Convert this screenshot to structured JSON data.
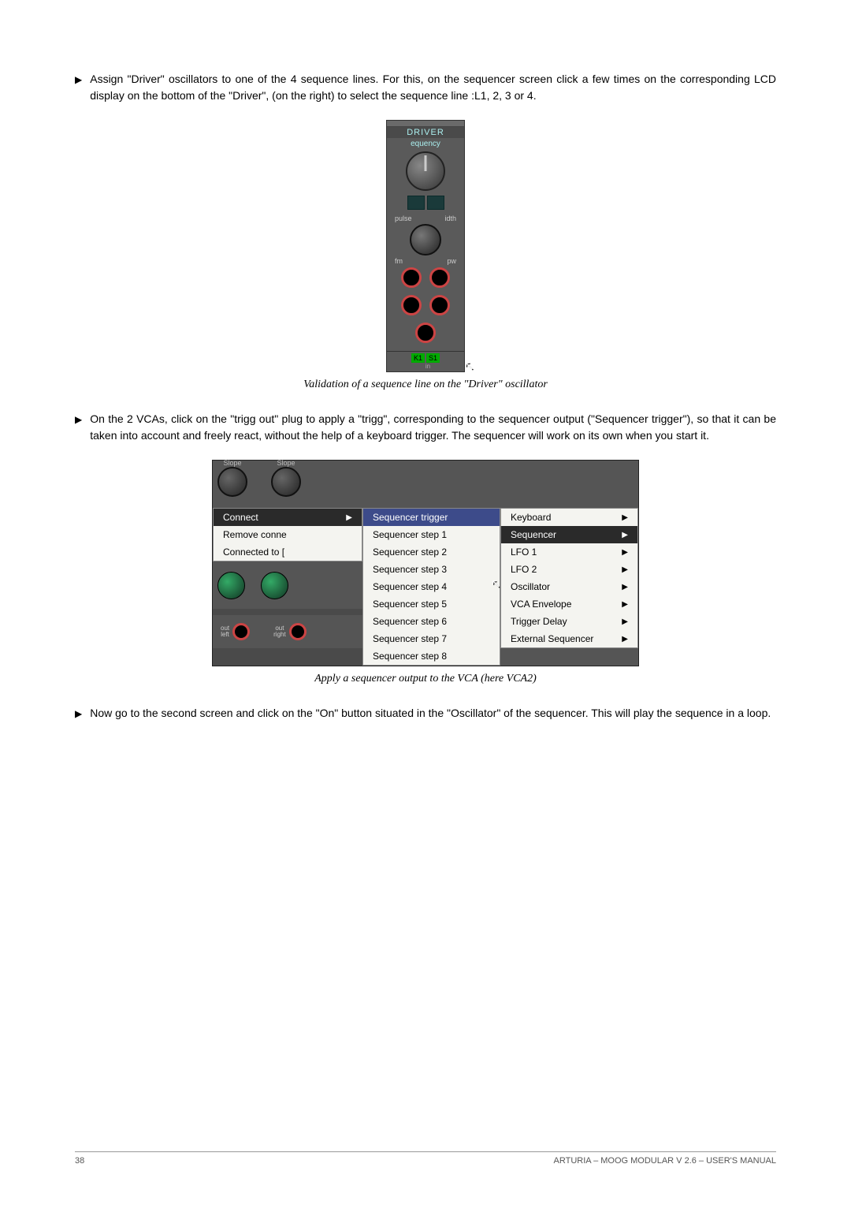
{
  "para1": "Assign \"Driver\" oscillators to one of the 4 sequence lines. For this, on the sequencer screen click a few times on the corresponding LCD display on the bottom of the \"Driver\", (on the right) to select the sequence line :L1, 2, 3 or 4.",
  "driver": {
    "title": "DRIVER",
    "sub": "equency",
    "pulse": "pulse",
    "idth": "idth",
    "fm": "fm",
    "pw": "pw",
    "k1": "K1",
    "s1": "S1",
    "in": "in"
  },
  "caption1": "Validation of a sequence line on the \"Driver\" oscillator",
  "para2": "On the 2 VCAs, click on the \"trigg out\" plug to apply a \"trigg\", corresponding to the sequencer output (\"Sequencer trigger\"), so that it can be taken into account and freely react, without the help of a keyboard trigger. The sequencer will work on its own when you start it.",
  "slope": "Slope",
  "leftmenu": {
    "connect": "Connect",
    "remove": "Remove conne",
    "connected": "Connected to ["
  },
  "midmenu": {
    "trigger": "Sequencer trigger",
    "step1": "Sequencer step 1",
    "step2": "Sequencer step 2",
    "step3": "Sequencer step 3",
    "step4": "Sequencer step 4",
    "step5": "Sequencer step 5",
    "step6": "Sequencer step 6",
    "step7": "Sequencer step 7",
    "step8": "Sequencer step 8"
  },
  "rightmenu": {
    "keyboard": "Keyboard",
    "sequencer": "Sequencer",
    "lfo1": "LFO 1",
    "lfo2": "LFO 2",
    "oscillator": "Oscillator",
    "vcaenv": "VCA Envelope",
    "trigdelay": "Trigger Delay",
    "extseq": "External Sequencer"
  },
  "outleft": "out\nleft",
  "outright": "out\nright",
  "caption2": "Apply a sequencer output to the VCA (here VCA2)",
  "para3": "Now go to the second screen and click on the \"On\" button situated in the \"Oscillator\" of the sequencer. This will play the sequence in a loop.",
  "footer": {
    "page": "38",
    "title": "ARTURIA – MOOG MODULAR V 2.6 – USER'S MANUAL"
  }
}
